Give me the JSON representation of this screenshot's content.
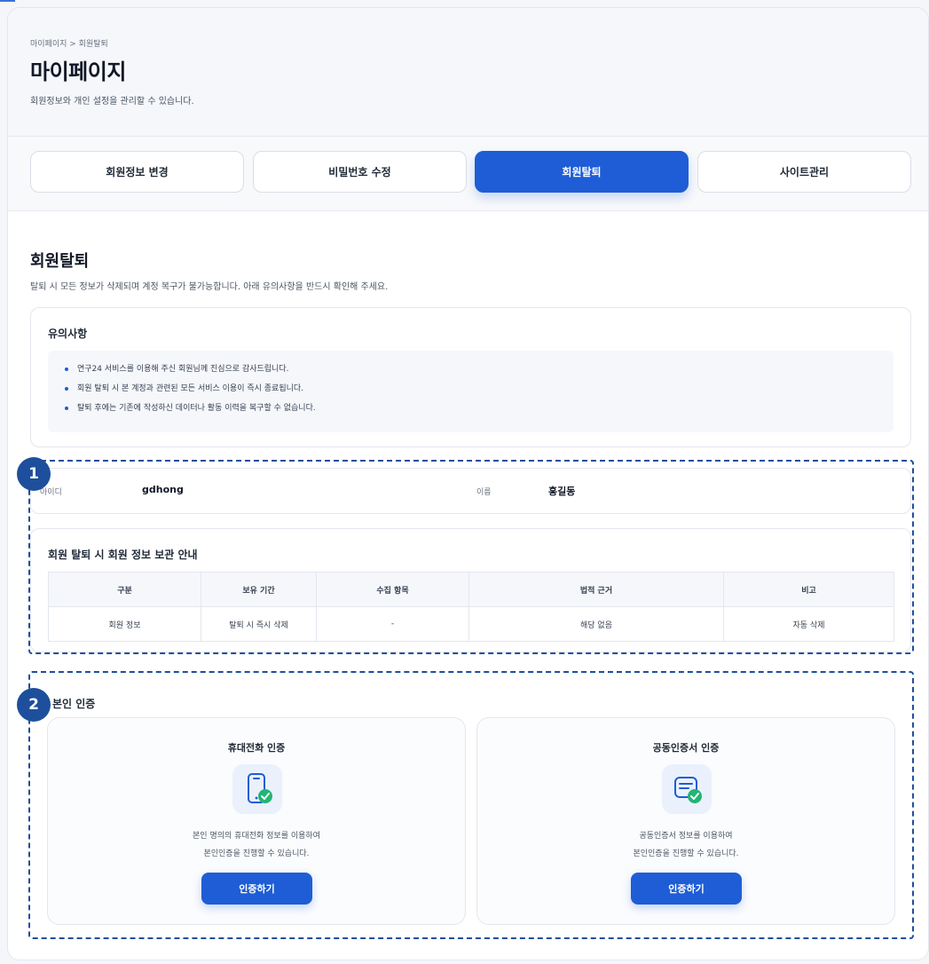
{
  "breadcrumb": "마이페이지 > 회원탈퇴",
  "page": {
    "title": "마이페이지",
    "description": "회원정보와 개인 설정을 관리할 수 있습니다."
  },
  "tabs": [
    {
      "label": "회원정보 변경",
      "active": false
    },
    {
      "label": "비밀번호 수정",
      "active": false
    },
    {
      "label": "회원탈퇴",
      "active": true
    },
    {
      "label": "사이트관리",
      "active": false
    }
  ],
  "section": {
    "title": "회원탈퇴",
    "description": "탈퇴 시 모든 정보가 삭제되며 계정 복구가 불가능합니다. 아래 유의사항을 반드시 확인해 주세요."
  },
  "notice": {
    "title": "유의사항",
    "items": [
      "연구24 서비스를 이용해 주신 회원님께 진심으로 감사드립니다.",
      "회원 탈퇴 시 본 계정과 관련된 모든 서비스 이용이 즉시 종료됩니다.",
      "탈퇴 후에는 기존에 작성하신 데이터나 활동 이력을 복구할 수 없습니다."
    ]
  },
  "account": {
    "id_label": "아이디",
    "id_value": "gdhong",
    "name_label": "이름",
    "name_value": "홍길동"
  },
  "retention": {
    "title": "회원 탈퇴 시 회원 정보 보관 안내",
    "headers": [
      "구분",
      "보유 기간",
      "수집 항목",
      "법적 근거",
      "비고"
    ],
    "rows": [
      [
        "회원 정보",
        "탈퇴 시 즉시 삭제",
        "-",
        "해당 없음",
        "자동 삭제"
      ]
    ]
  },
  "auth": {
    "title": "본인 인증",
    "methods": [
      {
        "title": "휴대전화 인증",
        "icon": "phone-check-icon",
        "line1": "본인 명의의 휴대전화 정보를 이용하여",
        "line2": "본인인증을 진행할 수 있습니다.",
        "button": "인증하기"
      },
      {
        "title": "공동인증서 인증",
        "icon": "certificate-check-icon",
        "line1": "공동인증서 정보를 이용하여",
        "line2": "본인인증을 진행할 수 있습니다.",
        "button": "인증하기"
      }
    ]
  },
  "annotations": [
    "1",
    "2"
  ],
  "colors": {
    "accent": "#1e5dd6",
    "annotation": "#1e4f9c",
    "check": "#22b573"
  }
}
